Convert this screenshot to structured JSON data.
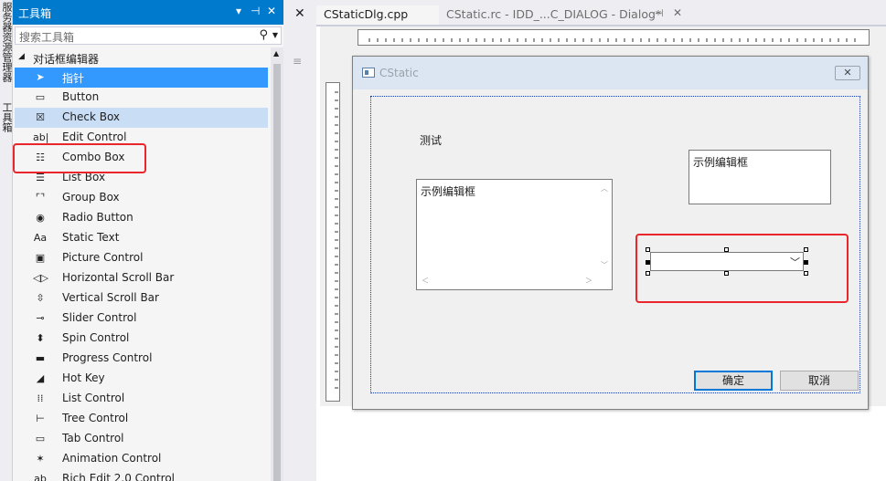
{
  "side_tabs": [
    "服务器资源管理器",
    "工具箱"
  ],
  "toolbox": {
    "title": "工具箱",
    "title_controls": [
      "▾",
      "⊣",
      "✕"
    ],
    "search_placeholder": "搜索工具箱",
    "group_label": "对话框编辑器",
    "items": [
      {
        "label": "指针",
        "icon": "pointer-icon",
        "glyph": "➤",
        "state": "selected"
      },
      {
        "label": "Button",
        "icon": "button-icon",
        "glyph": "▭",
        "state": ""
      },
      {
        "label": "Check Box",
        "icon": "checkbox-icon",
        "glyph": "☒",
        "state": "hover"
      },
      {
        "label": "Edit Control",
        "icon": "edit-control-icon",
        "glyph": "ab|",
        "state": ""
      },
      {
        "label": "Combo Box",
        "icon": "combo-box-icon",
        "glyph": "☷",
        "state": ""
      },
      {
        "label": "List Box",
        "icon": "list-box-icon",
        "glyph": "☰",
        "state": ""
      },
      {
        "label": "Group Box",
        "icon": "group-box-icon",
        "glyph": "⌜⌝",
        "state": ""
      },
      {
        "label": "Radio Button",
        "icon": "radio-button-icon",
        "glyph": "◉",
        "state": ""
      },
      {
        "label": "Static Text",
        "icon": "static-text-icon",
        "glyph": "Aa",
        "state": ""
      },
      {
        "label": "Picture Control",
        "icon": "picture-control-icon",
        "glyph": "▣",
        "state": ""
      },
      {
        "label": "Horizontal Scroll Bar",
        "icon": "hscroll-bar-icon",
        "glyph": "◁▷",
        "state": ""
      },
      {
        "label": "Vertical Scroll Bar",
        "icon": "vscroll-bar-icon",
        "glyph": "⇳",
        "state": ""
      },
      {
        "label": "Slider Control",
        "icon": "slider-control-icon",
        "glyph": "⊸",
        "state": ""
      },
      {
        "label": "Spin Control",
        "icon": "spin-control-icon",
        "glyph": "⬍",
        "state": ""
      },
      {
        "label": "Progress Control",
        "icon": "progress-control-icon",
        "glyph": "▬",
        "state": ""
      },
      {
        "label": "Hot Key",
        "icon": "hot-key-icon",
        "glyph": "◢",
        "state": ""
      },
      {
        "label": "List Control",
        "icon": "list-control-icon",
        "glyph": "⁞⁞",
        "state": ""
      },
      {
        "label": "Tree Control",
        "icon": "tree-control-icon",
        "glyph": "⊢",
        "state": ""
      },
      {
        "label": "Tab Control",
        "icon": "tab-control-icon",
        "glyph": "▭",
        "state": ""
      },
      {
        "label": "Animation Control",
        "icon": "animation-control-icon",
        "glyph": "✶",
        "state": ""
      },
      {
        "label": "Rich Edit 2.0 Control",
        "icon": "rich-edit-icon",
        "glyph": "ab",
        "state": ""
      }
    ]
  },
  "doc_tabs": [
    {
      "label": "CStaticDlg.cpp",
      "active": true
    },
    {
      "label": "CStatic.rc - IDD_...C_DIALOG - Dialog*",
      "active": false
    }
  ],
  "dialog": {
    "title": "CStatic",
    "close_glyph": "✕",
    "static_label": "测试",
    "edit_top_text": "示例编辑框",
    "edit_multiline_text": "示例编辑框",
    "ok_label": "确定",
    "cancel_label": "取消"
  },
  "colors": {
    "accent": "#007acc",
    "selection": "#3399ff",
    "hover": "#c9def5",
    "annotation_red": "#e8262c"
  }
}
